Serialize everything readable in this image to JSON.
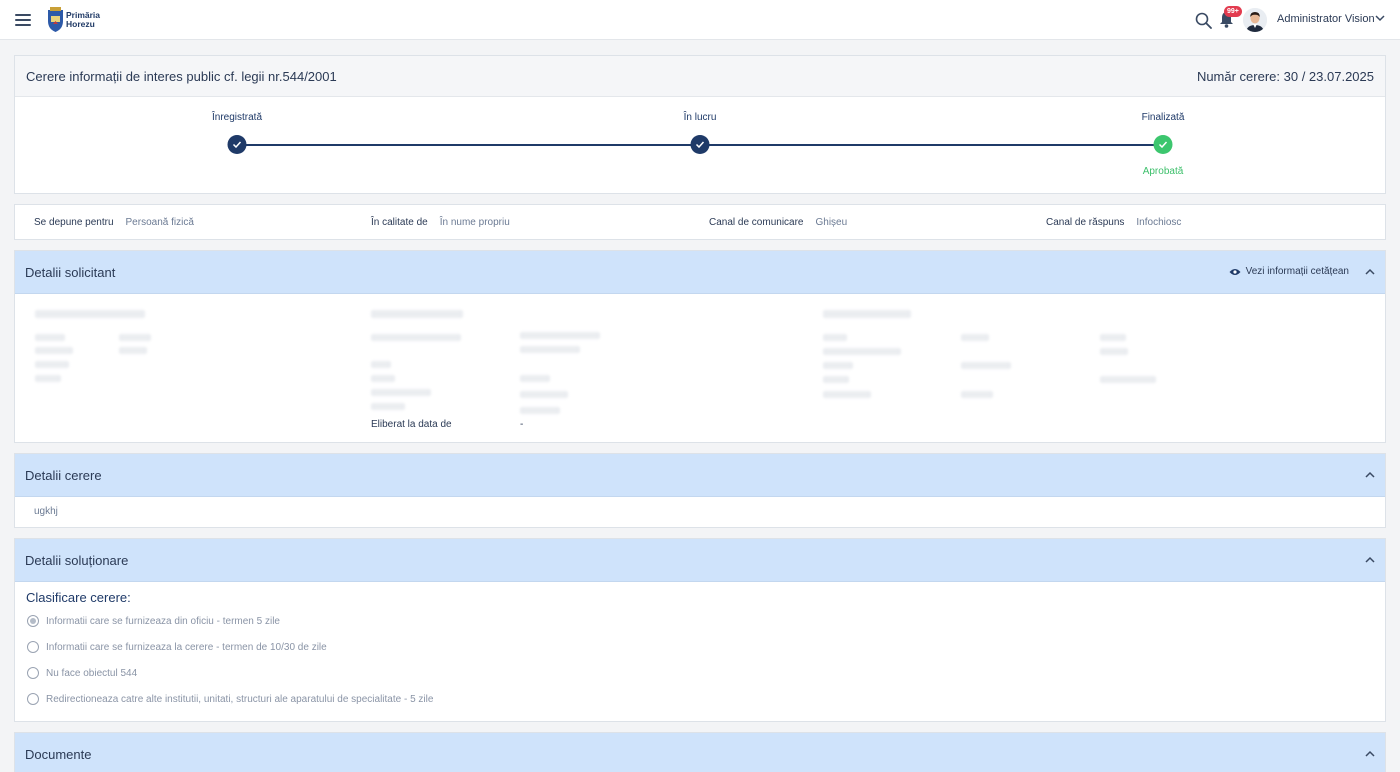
{
  "header": {
    "logo_line1": "Primăria",
    "logo_line2": "Horezu",
    "notification_badge": "99+",
    "user_name": "Administrator Vision"
  },
  "request": {
    "title": "Cerere informații de interes public cf. legii nr.544/2001",
    "number": "Număr cerere: 30 / 23.07.2025",
    "steps": [
      {
        "label": "Înregistrată",
        "status": ""
      },
      {
        "label": "În lucru",
        "status": ""
      },
      {
        "label": "Finalizată",
        "status": "Aprobată"
      }
    ]
  },
  "info": [
    {
      "key": "Se depune pentru",
      "value": "Persoană fizică"
    },
    {
      "key": "În calitate de",
      "value": "În nume propriu"
    },
    {
      "key": "Canal de comunicare",
      "value": "Ghișeu"
    },
    {
      "key": "Canal de răspuns",
      "value": "Infochiosc"
    }
  ],
  "solicitant": {
    "title": "Detalii solicitant",
    "view_link": "Vezi informații cetățean",
    "issued_label": "Eliberat la data de",
    "issued_value": "-"
  },
  "cerere": {
    "title": "Detalii cerere",
    "text": "ugkhj"
  },
  "solutionare": {
    "title": "Detalii soluționare",
    "classification_title": "Clasificare cerere:",
    "options": [
      {
        "label": "Informatii care se furnizeaza din oficiu - termen 5 zile",
        "checked": true
      },
      {
        "label": "Informatii care se furnizeaza la cerere - termen de 10/30 de zile",
        "checked": false
      },
      {
        "label": "Nu face obiectul 544",
        "checked": false
      },
      {
        "label": "Redirectioneaza catre alte institutii, unitati, structuri ale aparatului de specialitate - 5 zile",
        "checked": false
      }
    ]
  },
  "documente": {
    "title": "Documente"
  },
  "colors": {
    "primary": "#1f3a68",
    "success": "#3cc66e",
    "section_header": "#cfe3fb",
    "badge": "#e23b4f"
  },
  "icons": {
    "menu": "hamburger-icon",
    "search": "search-icon",
    "notifications": "bell-icon",
    "expand": "chevron-up-icon",
    "view": "eye-icon",
    "step_done": "check-icon"
  }
}
